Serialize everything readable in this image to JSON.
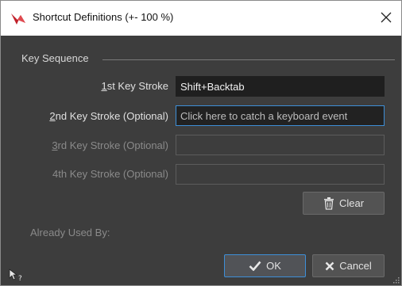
{
  "window": {
    "title": "Shortcut Definitions (+- 100 %)"
  },
  "group": {
    "title": "Key Sequence"
  },
  "rows": [
    {
      "mnemonic": "1",
      "rest": "st Key Stroke",
      "value": "Shift+Backtab",
      "placeholder": "",
      "state": "filled"
    },
    {
      "mnemonic": "2",
      "rest": "nd Key Stroke (Optional)",
      "value": "",
      "placeholder": "Click here to catch a keyboard event",
      "state": "focused"
    },
    {
      "mnemonic": "3",
      "rest": "rd Key Stroke (Optional)",
      "value": "",
      "placeholder": "",
      "state": "disabled"
    },
    {
      "mnemonic": "",
      "rest": "4th Key Stroke (Optional)",
      "value": "",
      "placeholder": "",
      "state": "disabled"
    }
  ],
  "buttons": {
    "clear_label": "Clear",
    "ok_label": "OK",
    "cancel_label": "Cancel"
  },
  "already_used_label": "Already Used By:",
  "icons": {
    "app": "app-logo-icon",
    "close": "close-icon",
    "clear": "trash-icon",
    "ok": "checkmark-icon",
    "cancel": "x-icon",
    "help": "help-cursor-icon"
  },
  "colors": {
    "accent": "#3d8fd8",
    "background": "#3d3d3d",
    "logo": "#c0202a"
  }
}
